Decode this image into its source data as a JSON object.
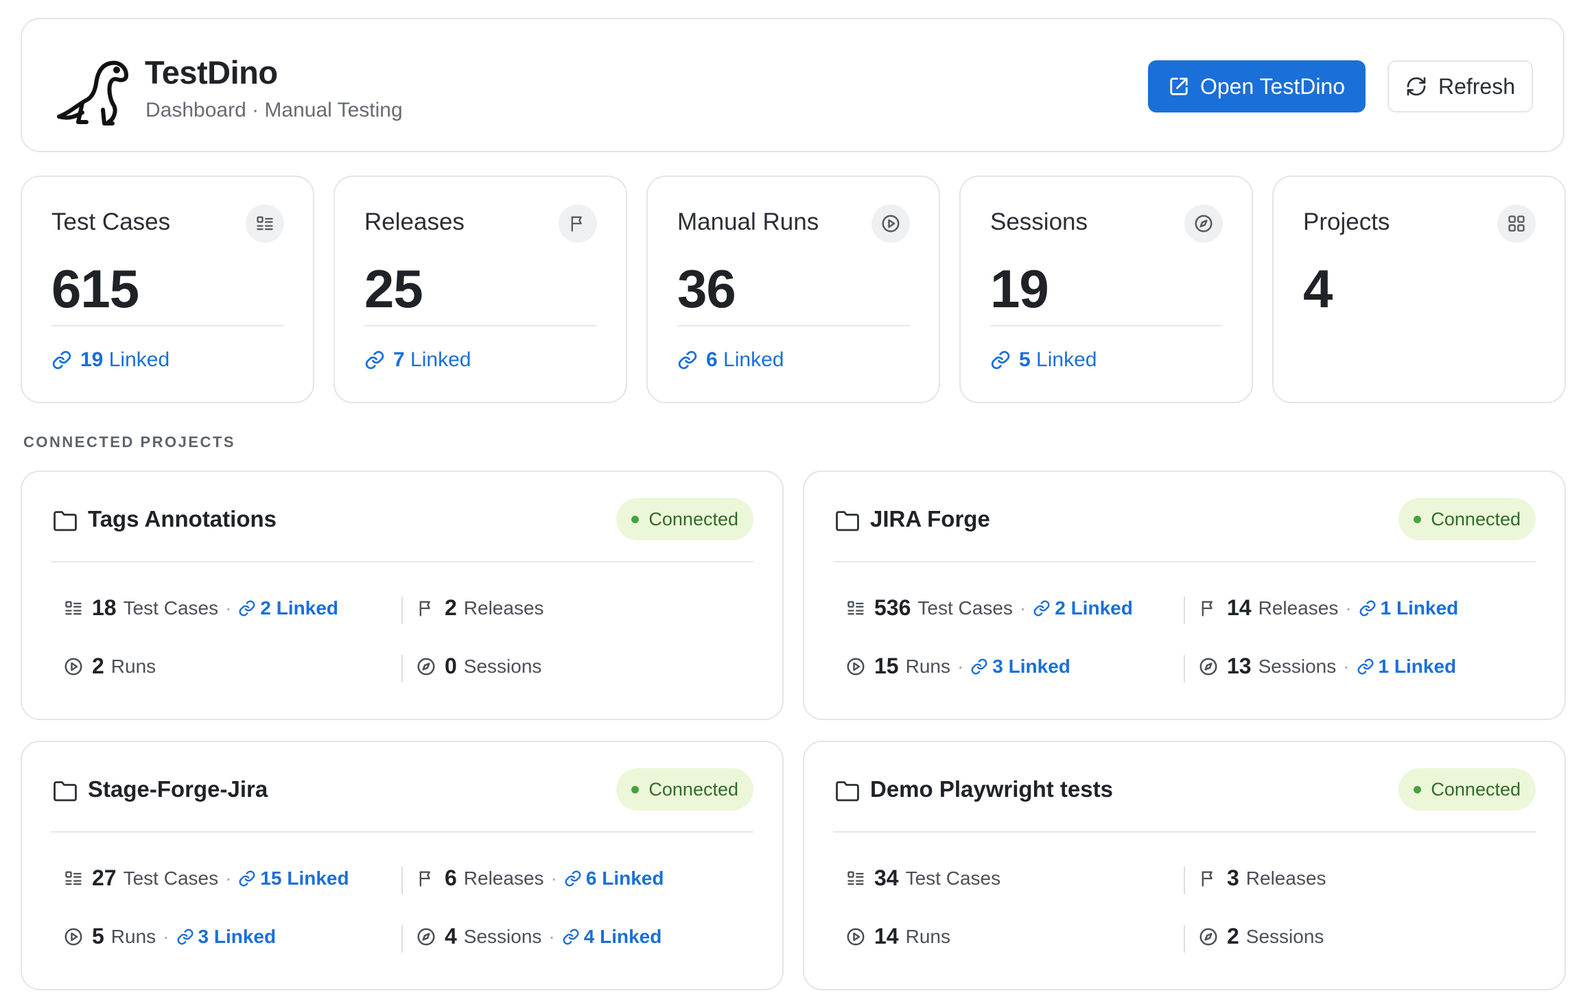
{
  "header": {
    "title": "TestDino",
    "subtitle": "Dashboard · Manual Testing",
    "open_button": "Open TestDino",
    "refresh_button": "Refresh"
  },
  "stats": [
    {
      "label": "Test Cases",
      "value": "615",
      "linked": "19",
      "icon": "list-icon"
    },
    {
      "label": "Releases",
      "value": "25",
      "linked": "7",
      "icon": "flag-icon"
    },
    {
      "label": "Manual Runs",
      "value": "36",
      "linked": "6",
      "icon": "play-icon"
    },
    {
      "label": "Sessions",
      "value": "19",
      "linked": "5",
      "icon": "compass-icon"
    },
    {
      "label": "Projects",
      "value": "4",
      "linked": null,
      "icon": "grid-icon"
    }
  ],
  "linked_word": "Linked",
  "section_title": "CONNECTED PROJECTS",
  "projects": [
    {
      "name": "Tags Annotations",
      "status": "Connected",
      "test_cases": {
        "count": "18",
        "label": "Test Cases",
        "linked": "2"
      },
      "releases": {
        "count": "2",
        "label": "Releases",
        "linked": null
      },
      "runs": {
        "count": "2",
        "label": "Runs",
        "linked": null
      },
      "sessions": {
        "count": "0",
        "label": "Sessions",
        "linked": null
      }
    },
    {
      "name": "JIRA Forge",
      "status": "Connected",
      "test_cases": {
        "count": "536",
        "label": "Test Cases",
        "linked": "2"
      },
      "releases": {
        "count": "14",
        "label": "Releases",
        "linked": "1"
      },
      "runs": {
        "count": "15",
        "label": "Runs",
        "linked": "3"
      },
      "sessions": {
        "count": "13",
        "label": "Sessions",
        "linked": "1"
      }
    },
    {
      "name": "Stage-Forge-Jira",
      "status": "Connected",
      "test_cases": {
        "count": "27",
        "label": "Test Cases",
        "linked": "15"
      },
      "releases": {
        "count": "6",
        "label": "Releases",
        "linked": "6"
      },
      "runs": {
        "count": "5",
        "label": "Runs",
        "linked": "3"
      },
      "sessions": {
        "count": "4",
        "label": "Sessions",
        "linked": "4"
      }
    },
    {
      "name": "Demo Playwright tests",
      "status": "Connected",
      "test_cases": {
        "count": "34",
        "label": "Test Cases",
        "linked": null
      },
      "releases": {
        "count": "3",
        "label": "Releases",
        "linked": null
      },
      "runs": {
        "count": "14",
        "label": "Runs",
        "linked": null
      },
      "sessions": {
        "count": "2",
        "label": "Sessions",
        "linked": null
      }
    }
  ],
  "colors": {
    "accent": "#1a6fd9",
    "connected_bg": "#ecf7d9",
    "connected_dot": "#46a243"
  }
}
